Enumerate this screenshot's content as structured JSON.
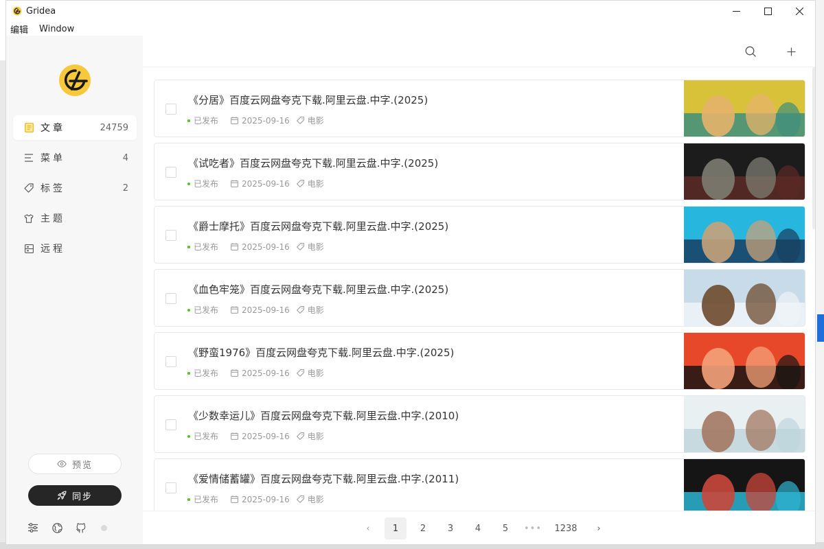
{
  "window": {
    "title": "Gridea",
    "controls": {
      "minimize": "—",
      "maximize": "☐",
      "close": "✕"
    }
  },
  "menu": [
    "编辑",
    "Window"
  ],
  "sidebar": {
    "logo_icon": "gridea-logo",
    "items": [
      {
        "label": "文章",
        "count": "24759",
        "icon": "article-icon",
        "active": true
      },
      {
        "label": "菜单",
        "count": "4",
        "icon": "menu-icon",
        "active": false
      },
      {
        "label": "标签",
        "count": "2",
        "icon": "tag-icon",
        "active": false
      },
      {
        "label": "主题",
        "count": "",
        "icon": "shirt-icon",
        "active": false
      },
      {
        "label": "远程",
        "count": "",
        "icon": "remote-icon",
        "active": false
      }
    ],
    "preview_label": "预览",
    "sync_label": "同步",
    "tools": [
      "settings-icon",
      "globe-icon",
      "github-icon"
    ]
  },
  "topbar": {
    "search_icon": "search-icon",
    "add_icon": "plus-icon"
  },
  "posts": [
    {
      "title": "《分居》百度云网盘夸克下载.阿里云盘.中字.(2025)",
      "status": "已发布",
      "date": "2025-09-16",
      "tag": "电影",
      "thumb_colors": [
        "#d8c23a",
        "#3e8f7c",
        "#e6b36b"
      ]
    },
    {
      "title": "《试吃者》百度云网盘夸克下载.阿里云盘.中字.(2025)",
      "status": "已发布",
      "date": "2025-09-16",
      "tag": "电影",
      "thumb_colors": [
        "#1c1c1c",
        "#5b2a25",
        "#7c7c72"
      ]
    },
    {
      "title": "《爵士摩托》百度云网盘夸克下载.阿里云盘.中字.(2025)",
      "status": "已发布",
      "date": "2025-09-16",
      "tag": "电影",
      "thumb_colors": [
        "#27b6de",
        "#183e61",
        "#c7a27a"
      ]
    },
    {
      "title": "《血色牢笼》百度云网盘夸克下载.阿里云盘.中字.(2025)",
      "status": "已发布",
      "date": "2025-09-16",
      "tag": "电影",
      "thumb_colors": [
        "#c8dbe8",
        "#eef4f8",
        "#6e4a2d"
      ]
    },
    {
      "title": "《野蛮1976》百度云网盘夸克下载.阿里云盘.中字.(2025)",
      "status": "已发布",
      "date": "2025-09-16",
      "tag": "电影",
      "thumb_colors": [
        "#e8482a",
        "#1a1512",
        "#f4a27a"
      ]
    },
    {
      "title": "《少数幸运儿》百度云网盘夸克下载.阿里云盘.中字.(2010)",
      "status": "已发布",
      "date": "2025-09-16",
      "tag": "电影",
      "thumb_colors": [
        "#e9f0f1",
        "#bfd6dd",
        "#a37862"
      ]
    },
    {
      "title": "《爱情储蓄罐》百度云网盘夸克下载.阿里云盘.中字.(2011)",
      "status": "已发布",
      "date": "2025-09-16",
      "tag": "电影",
      "thumb_colors": [
        "#151515",
        "#2db4d1",
        "#c9473b"
      ]
    }
  ],
  "pagination": {
    "prev": "‹",
    "pages": [
      "1",
      "2",
      "3",
      "4",
      "5"
    ],
    "ellipsis": "•••",
    "last": "1238",
    "next": "›",
    "current": "1"
  },
  "colors": {
    "accent": "#f8c83c",
    "published": "#52c41a",
    "sync_bg": "#262626"
  }
}
